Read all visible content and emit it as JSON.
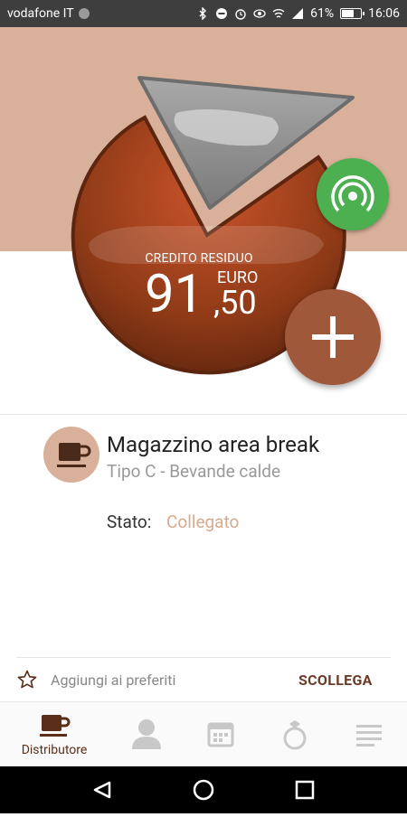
{
  "status_bar": {
    "carrier": "vodafone IT",
    "battery": "61%",
    "time": "16:06"
  },
  "hero": {
    "credit_label": "CREDITO RESIDUO",
    "amount_integer": "91",
    "amount_decimal": ",50",
    "currency": "EURO"
  },
  "machine": {
    "title": "Magazzino area break",
    "subtitle": "Tipo C - Bevande calde",
    "state_label": "Stato:",
    "state_value": "Collegato"
  },
  "actions": {
    "favorite_label": "Aggiungi ai preferiti",
    "disconnect_label": "SCOLLEGA"
  },
  "bottom_nav": {
    "items": [
      {
        "label": "Distributore",
        "icon": "coffee-cup-icon",
        "active": true
      },
      {
        "label": "",
        "icon": "person-icon",
        "active": false
      },
      {
        "label": "",
        "icon": "calendar-icon",
        "active": false
      },
      {
        "label": "",
        "icon": "ring-icon",
        "active": false
      },
      {
        "label": "",
        "icon": "menu-icon",
        "active": false
      }
    ]
  },
  "colors": {
    "accent_brown": "#a0583a",
    "hero_beige": "#d9b19a",
    "nfc_green": "#4caf50",
    "dark_brown": "#5b2e1a"
  }
}
